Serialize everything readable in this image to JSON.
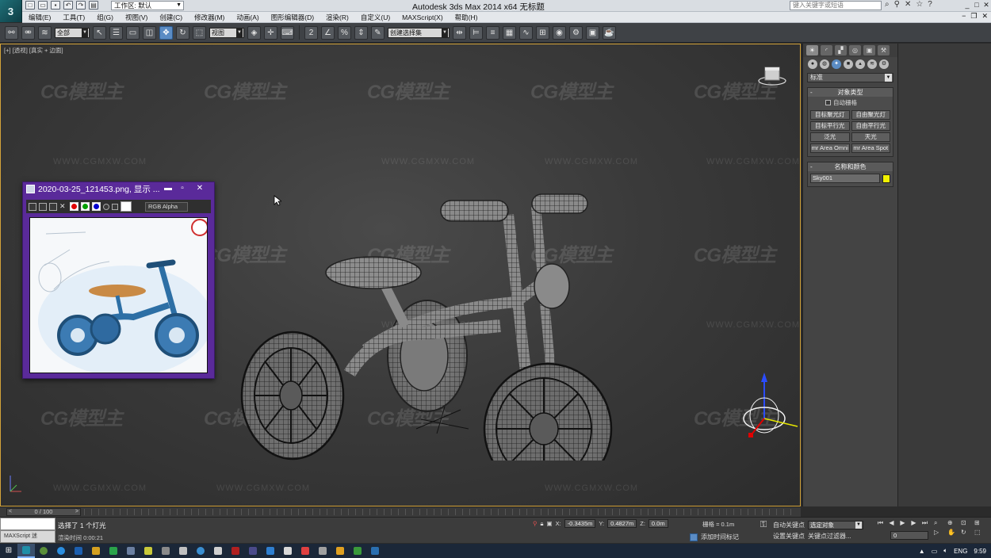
{
  "app": {
    "logo_letter": "3",
    "title": "Autodesk 3ds Max  2014 x64     无标题",
    "workspace": "工作区: 默认",
    "search_placeholder": "键入关键字或短语"
  },
  "menu": [
    "编辑(E)",
    "工具(T)",
    "组(G)",
    "视图(V)",
    "创建(C)",
    "修改器(M)",
    "动画(A)",
    "图形编辑器(D)",
    "渲染(R)",
    "自定义(U)",
    "MAXScript(X)",
    "帮助(H)"
  ],
  "toolbar": {
    "selection_filter": "全部",
    "reference_coord": "视图",
    "named_selection": "创建选择集"
  },
  "viewport": {
    "label": "[+] [透视] [真实 + 边面]",
    "watermark": "CG模型主",
    "watermark_url": "WWW.CGMXW.COM"
  },
  "image_window": {
    "title": "2020-03-25_121453.png, 显示 ...",
    "channel": "RGB Alpha",
    "min": "▬",
    "max": "▫",
    "close": "✕",
    "channel_colors": [
      "#e00000",
      "#00a000",
      "#0000d0"
    ]
  },
  "command_panel": {
    "category": "标准",
    "rollout_object_type": "对象类型",
    "autogrid": "自动栅格",
    "buttons": [
      "目标聚光灯",
      "自由聚光灯",
      "目标平行光",
      "自由平行光",
      "泛光",
      "天光",
      "mr Area Omni",
      "mr Area Spot"
    ],
    "rollout_name_color": "名称和颜色",
    "object_name": "Sky001",
    "object_color": "#f1f100"
  },
  "timeline": {
    "slider": "0 / 100",
    "left": "<",
    "right": ">"
  },
  "status": {
    "maxscript": "MAXScript 迷",
    "message": "选择了 1 个灯光",
    "render_time": "渲染时间 0:00:21",
    "x_label": "X:",
    "x": "-0.3435m",
    "y_label": "Y:",
    "y": "0.4827m",
    "z_label": "Z:",
    "z": "0.0m",
    "grid": "栅格 = 0.1m",
    "add_time_tag": "添加时间标记",
    "auto_key": "自动关键点",
    "set_key": "设置关键点",
    "key_mode": "选定对象",
    "key_filters": "关键点过滤器...",
    "frame": "0"
  },
  "taskbar": {
    "lang": "ENG",
    "time": "9:59"
  }
}
